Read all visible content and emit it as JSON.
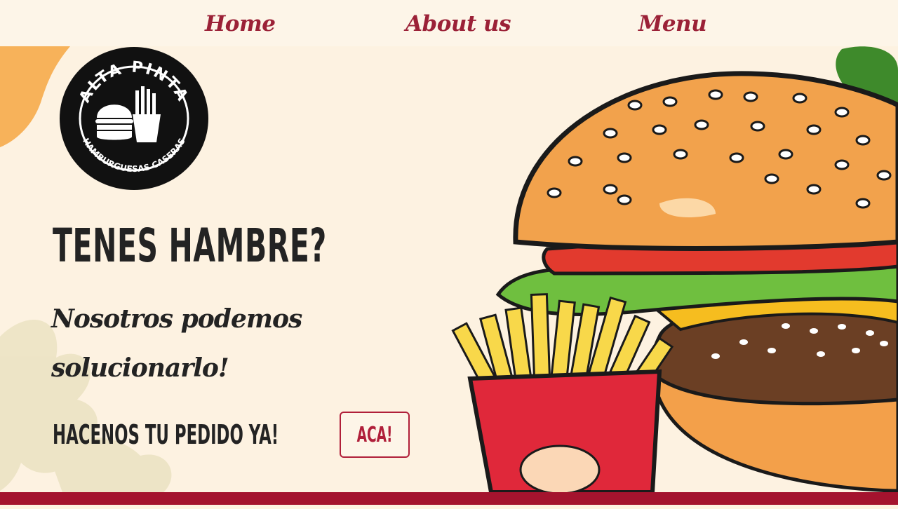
{
  "nav": {
    "items": [
      {
        "label": "Home"
      },
      {
        "label": "About us"
      },
      {
        "label": "Menu"
      }
    ]
  },
  "logo": {
    "top_text": "ALTA PINTA",
    "bottom_text": "HAMBURGUESAS CASERAS"
  },
  "hero": {
    "headline": "TENES HAMBRE?",
    "subline_1": "Nosotros podemos",
    "subline_2": "solucionarlo!",
    "cta_text": "HACENOS TU PEDIDO YA!",
    "cta_button": "ACA!"
  },
  "colors": {
    "brand_red": "#a4132e",
    "nav_text": "#9b2137",
    "background": "#fdf2e1",
    "accent_orange": "#f7b25a"
  },
  "icons": [
    "burger-illustration",
    "fries-illustration",
    "leaf-decoration"
  ]
}
